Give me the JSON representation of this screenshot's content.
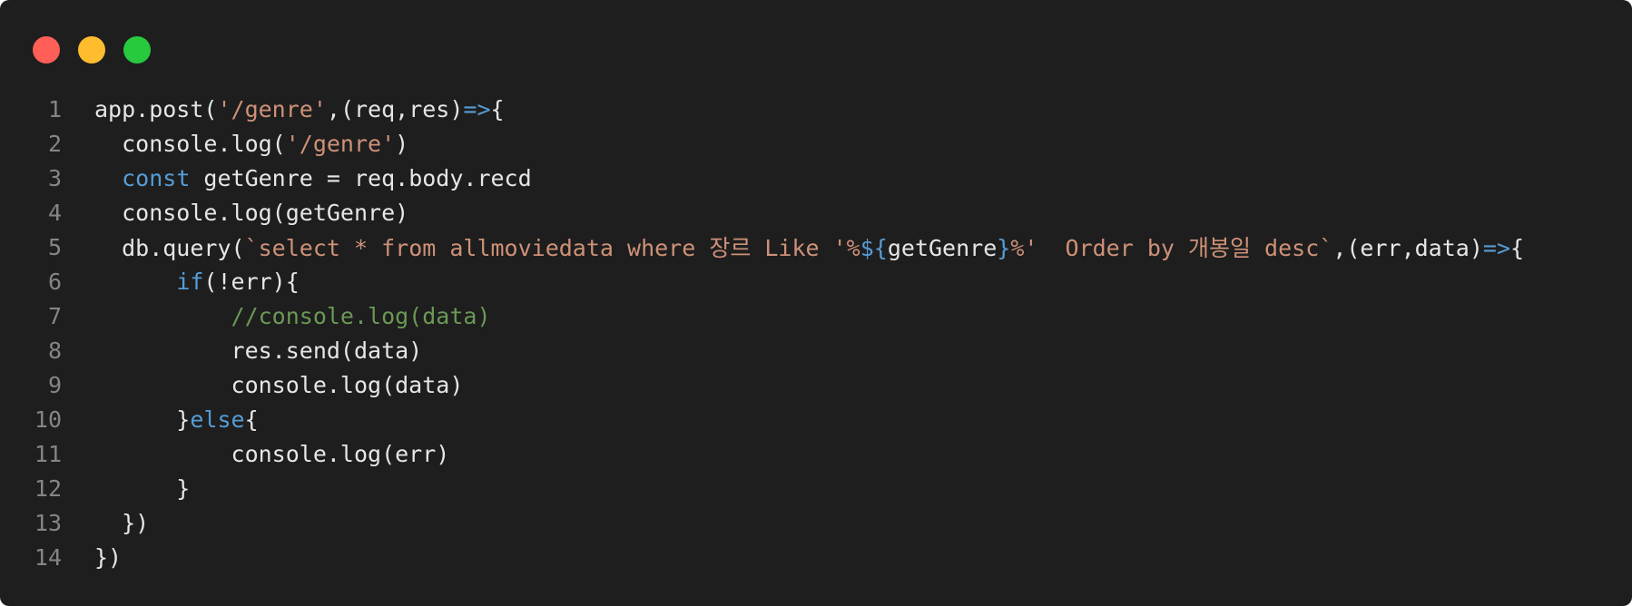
{
  "window": {
    "controls": [
      {
        "name": "close",
        "color": "#ff5f56"
      },
      {
        "name": "minimize",
        "color": "#ffbd2e"
      },
      {
        "name": "maximize",
        "color": "#27c93f"
      }
    ]
  },
  "colors": {
    "background": "#1e1e1e",
    "plain": "#e6e6e6",
    "string": "#ce9178",
    "keyword": "#569cd6",
    "comment": "#6a9955",
    "line_number": "#858585"
  },
  "code": {
    "lines": [
      {
        "n": "1",
        "tokens": [
          {
            "t": "app.post(",
            "k": "plain"
          },
          {
            "t": "'/genre'",
            "k": "str"
          },
          {
            "t": ",(req,res)",
            "k": "plain"
          },
          {
            "t": "=>",
            "k": "kw"
          },
          {
            "t": "{",
            "k": "plain"
          }
        ]
      },
      {
        "n": "2",
        "tokens": [
          {
            "t": "  console.log(",
            "k": "plain"
          },
          {
            "t": "'/genre'",
            "k": "str"
          },
          {
            "t": ")",
            "k": "plain"
          }
        ]
      },
      {
        "n": "3",
        "tokens": [
          {
            "t": "  ",
            "k": "plain"
          },
          {
            "t": "const",
            "k": "kw"
          },
          {
            "t": " getGenre = req.body.recd",
            "k": "plain"
          }
        ]
      },
      {
        "n": "4",
        "tokens": [
          {
            "t": "  console.log(getGenre)",
            "k": "plain"
          }
        ]
      },
      {
        "n": "5",
        "tokens": [
          {
            "t": "  db.query(",
            "k": "plain"
          },
          {
            "t": "`select * from allmoviedata where 장르 Like '%",
            "k": "str"
          },
          {
            "t": "${",
            "k": "kw"
          },
          {
            "t": "getGenre",
            "k": "plain"
          },
          {
            "t": "}",
            "k": "kw"
          },
          {
            "t": "%'  Order by 개봉일 desc`",
            "k": "str"
          },
          {
            "t": ",(err,data)",
            "k": "plain"
          },
          {
            "t": "=>",
            "k": "kw"
          },
          {
            "t": "{",
            "k": "plain"
          }
        ]
      },
      {
        "n": "6",
        "tokens": [
          {
            "t": "      ",
            "k": "plain"
          },
          {
            "t": "if",
            "k": "kw"
          },
          {
            "t": "(!err){",
            "k": "plain"
          }
        ]
      },
      {
        "n": "7",
        "tokens": [
          {
            "t": "          ",
            "k": "plain"
          },
          {
            "t": "//console.log(data)",
            "k": "com"
          }
        ]
      },
      {
        "n": "8",
        "tokens": [
          {
            "t": "          res.send(data)",
            "k": "plain"
          }
        ]
      },
      {
        "n": "9",
        "tokens": [
          {
            "t": "          console.log(data)",
            "k": "plain"
          }
        ]
      },
      {
        "n": "10",
        "tokens": [
          {
            "t": "      }",
            "k": "plain"
          },
          {
            "t": "else",
            "k": "kw"
          },
          {
            "t": "{",
            "k": "plain"
          }
        ]
      },
      {
        "n": "11",
        "tokens": [
          {
            "t": "          console.log(err)",
            "k": "plain"
          }
        ]
      },
      {
        "n": "12",
        "tokens": [
          {
            "t": "      }",
            "k": "plain"
          }
        ]
      },
      {
        "n": "13",
        "tokens": [
          {
            "t": "  })",
            "k": "plain"
          }
        ]
      },
      {
        "n": "14",
        "tokens": [
          {
            "t": "})",
            "k": "plain"
          }
        ]
      }
    ]
  }
}
